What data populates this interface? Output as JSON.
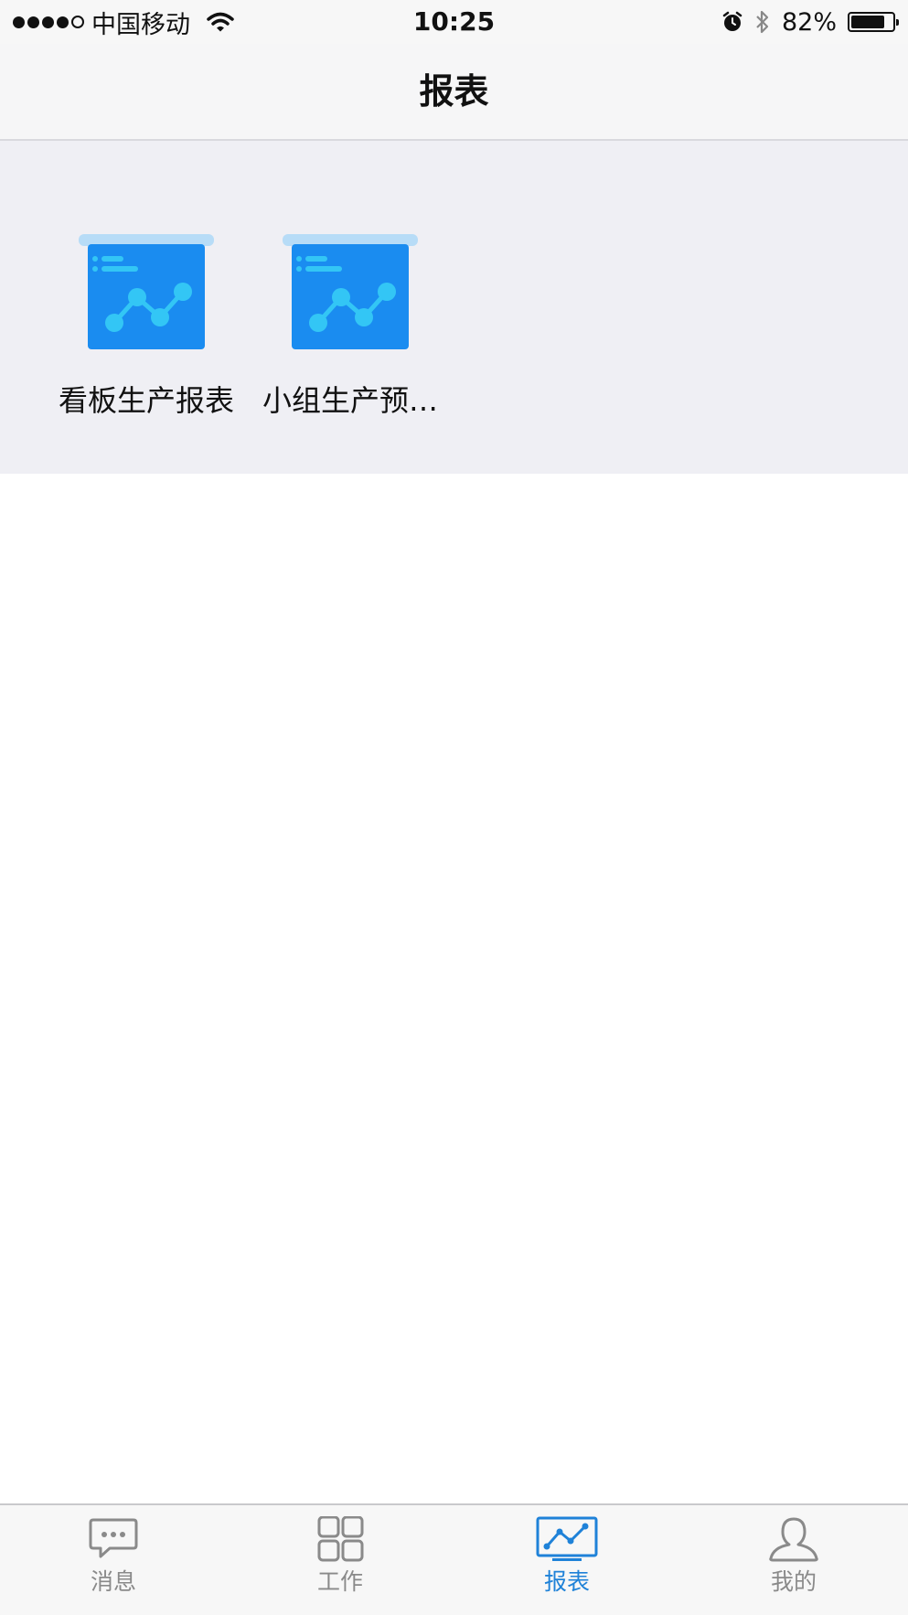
{
  "status_bar": {
    "carrier": "中国移动",
    "time": "10:25",
    "battery_percent": "82%",
    "battery_level": 0.82,
    "icons": [
      "signal-dots-icon",
      "wifi-icon",
      "alarm-icon",
      "bluetooth-icon",
      "battery-icon"
    ]
  },
  "nav": {
    "title": "报表"
  },
  "reports": [
    {
      "label": "看板生产报表",
      "icon": "report-chart-icon"
    },
    {
      "label": "小组生产预…",
      "icon": "report-chart-icon"
    }
  ],
  "tab_bar": {
    "active": "报表",
    "accent_color": "#1f82d8",
    "inactive_color": "#8a8a8a",
    "tabs": [
      {
        "label": "消息",
        "icon": "chat-bubble-icon"
      },
      {
        "label": "工作",
        "icon": "grid-icon"
      },
      {
        "label": "报表",
        "icon": "line-chart-icon"
      },
      {
        "label": "我的",
        "icon": "person-icon"
      }
    ]
  }
}
